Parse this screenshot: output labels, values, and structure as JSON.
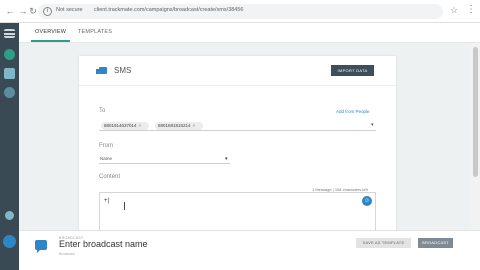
{
  "browser": {
    "security_label": "Not secure",
    "url": "client.trackmate.com/campaigns/broadcast/create/sms/38456"
  },
  "tabs": {
    "overview": "OVERVIEW",
    "templates": "TEMPLATES"
  },
  "card": {
    "title": "SMS",
    "import_button": "IMPORT DATA",
    "to_label": "To",
    "add_people_link": "Add from People",
    "recipients": [
      "8801914637014",
      "8801681815214"
    ],
    "chip_remove": "×",
    "from_label": "From",
    "from_value": "Name",
    "content_label": "Content",
    "char_count": "1 Message | 158 characters left",
    "content_value": "+|"
  },
  "bottom_bar": {
    "small_label": "BROADCAST",
    "name_placeholder": "Enter broadcast name",
    "sub_label": "Broadcast",
    "draft_button": "SAVE AS TEMPLATE",
    "send_button": "BROADCAST"
  },
  "icons": {
    "accent": "#2e9e8a",
    "brand": "#2f86c7",
    "sidebar_bg": "#3a4a54"
  }
}
